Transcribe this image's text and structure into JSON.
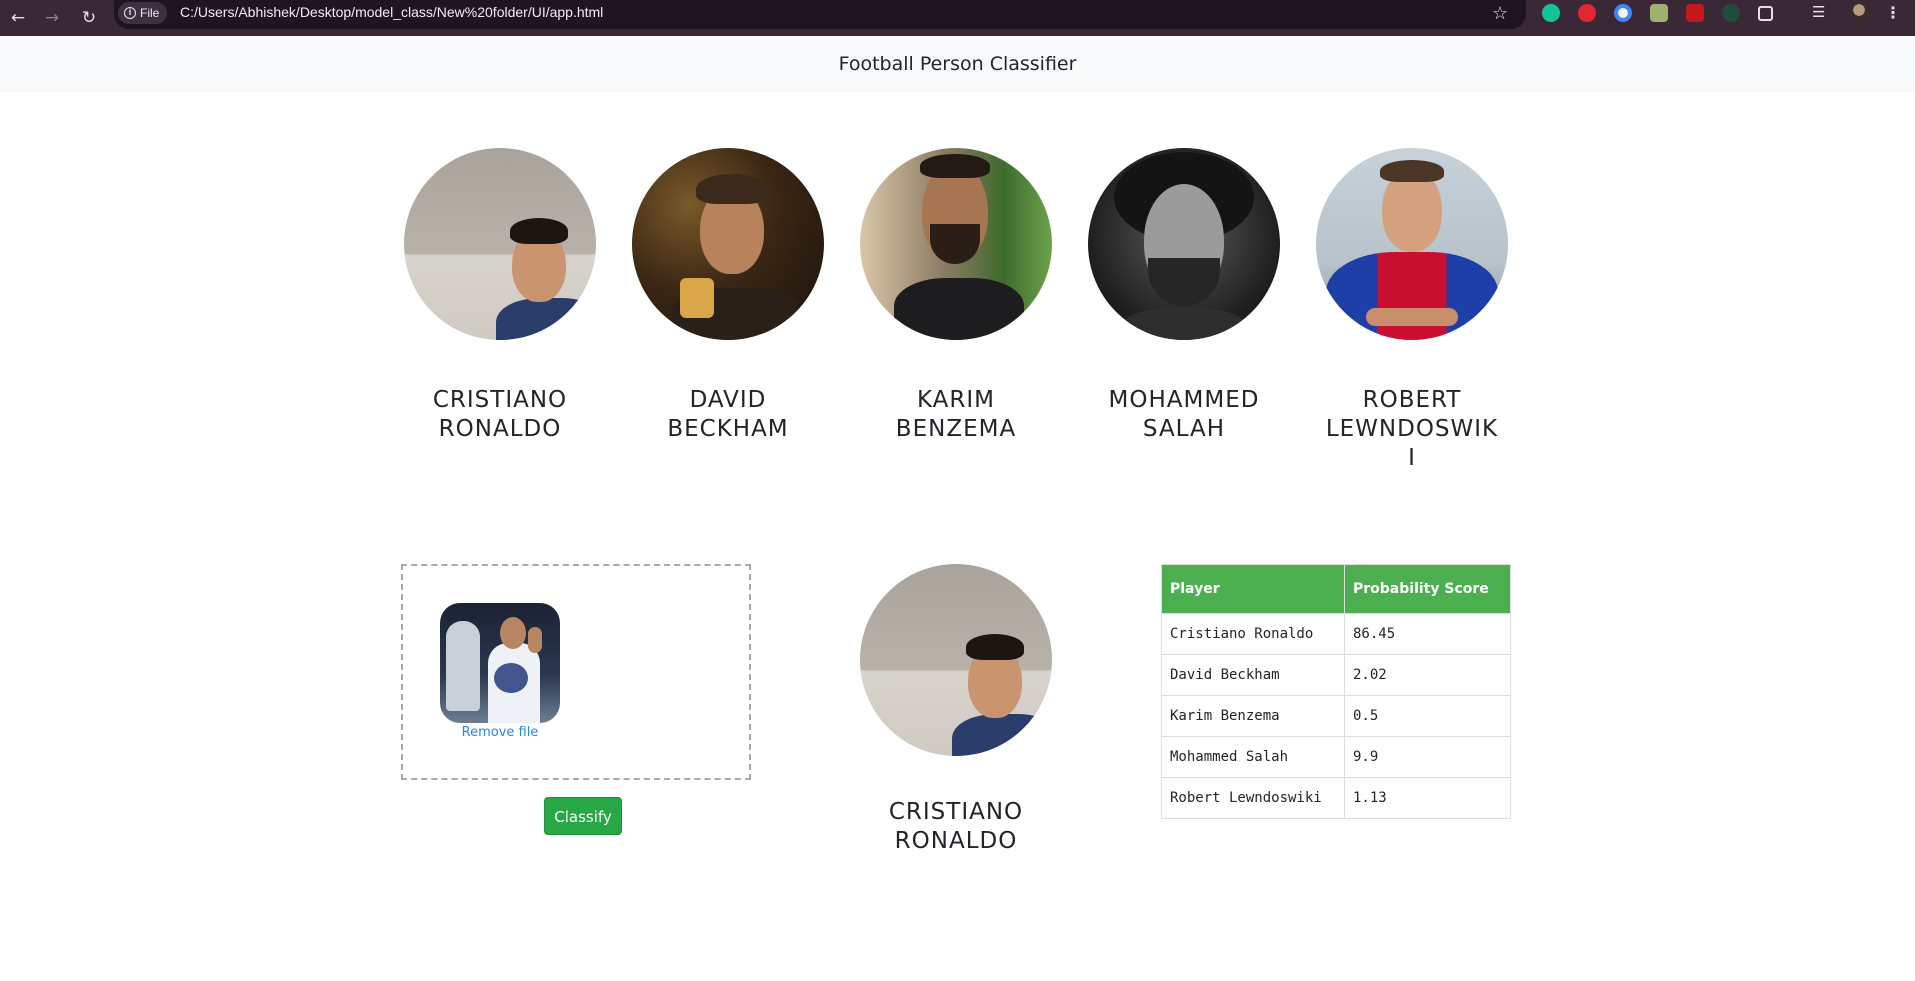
{
  "browser": {
    "site_chip": "File",
    "url": "C:/Users/Abhishek/Desktop/model_class/New%20folder/UI/app.html"
  },
  "navbar": {
    "brand": "Football Person Classifier"
  },
  "players": [
    {
      "name": "CRISTIANO RONALDO"
    },
    {
      "name": "DAVID BECKHAM"
    },
    {
      "name": "KARIM BENZEMA"
    },
    {
      "name": "MOHAMMED SALAH"
    },
    {
      "name": "ROBERT LEWNDOSWIKI"
    }
  ],
  "upload": {
    "remove_label": "Remove file"
  },
  "classify_label": "Classify",
  "result": {
    "name": "CRISTIANO RONALDO"
  },
  "table": {
    "headers": [
      "Player",
      "Probability Score"
    ],
    "rows": [
      [
        "Cristiano Ronaldo",
        "86.45"
      ],
      [
        "David Beckham",
        "2.02"
      ],
      [
        "Karim Benzema",
        "0.5"
      ],
      [
        "Mohammed Salah",
        "9.9"
      ],
      [
        "Robert Lewndoswiki",
        "1.13"
      ]
    ]
  }
}
